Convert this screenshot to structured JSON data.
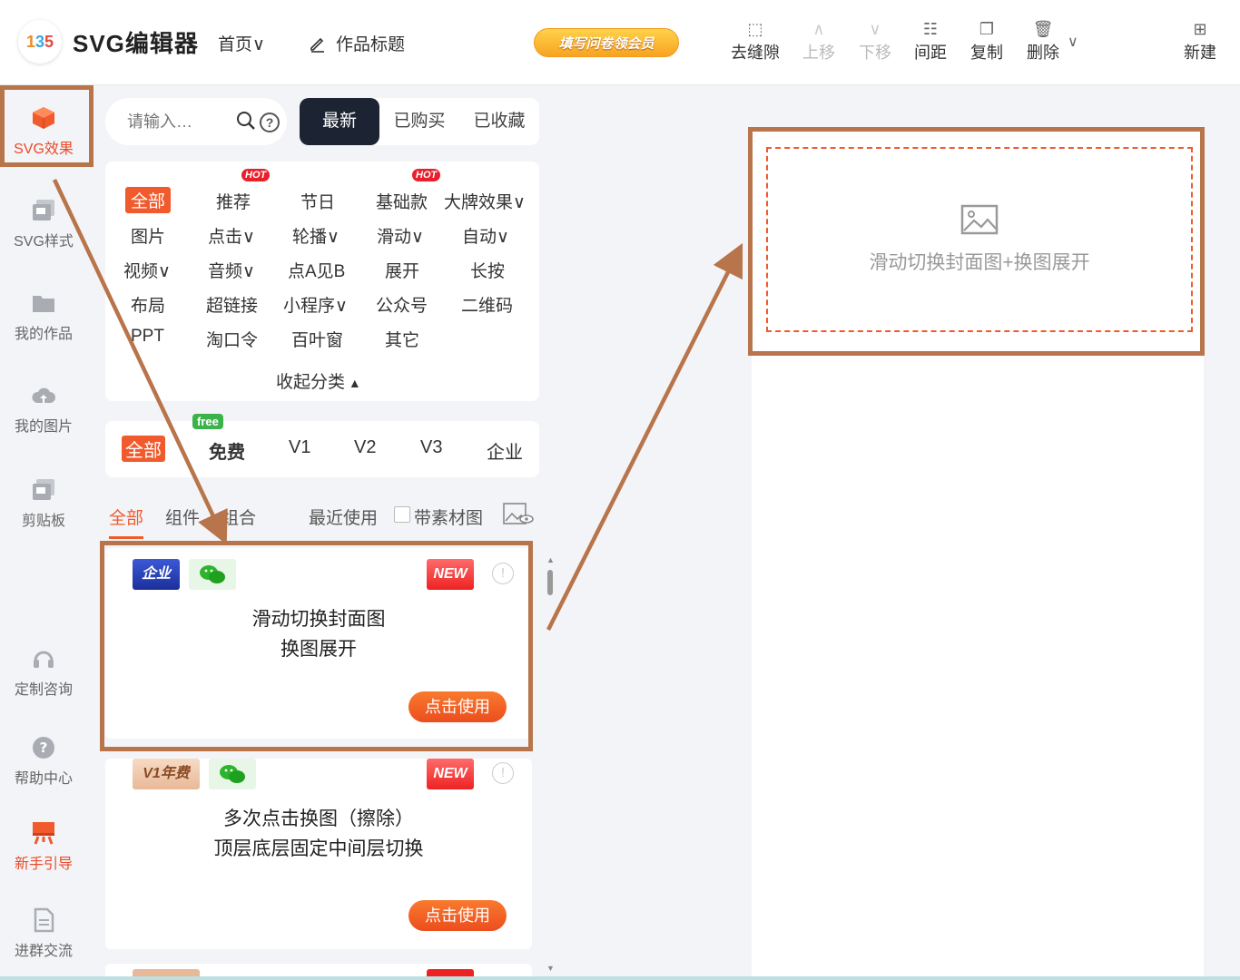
{
  "header": {
    "app_title": "SVG编辑器",
    "logo_text": [
      "1",
      "3",
      "5"
    ],
    "home_menu": "首页∨",
    "work_title": "作品标题",
    "promo": "填写问卷领会员",
    "toolbar": {
      "remove_gap": "去缝隙",
      "move_up": "上移",
      "move_down": "下移",
      "spacing": "间距",
      "copy": "复制",
      "delete": "删除",
      "new": "新建"
    }
  },
  "leftnav": {
    "items": [
      {
        "label": "SVG效果",
        "icon": "cube-icon"
      },
      {
        "label": "SVG样式",
        "icon": "style-icon"
      },
      {
        "label": "我的作品",
        "icon": "folder-icon"
      },
      {
        "label": "我的图片",
        "icon": "cloud-upload-icon"
      },
      {
        "label": "剪贴板",
        "icon": "clipboard-icon"
      },
      {
        "label": "定制咨询",
        "icon": "headset-icon"
      },
      {
        "label": "帮助中心",
        "icon": "help-icon"
      },
      {
        "label": "新手引导",
        "icon": "guide-icon"
      },
      {
        "label": "进群交流",
        "icon": "doc-icon"
      }
    ]
  },
  "search": {
    "placeholder": "请输入…"
  },
  "top_tabs": [
    "最新",
    "已购买",
    "已收藏"
  ],
  "categories": {
    "items": [
      "全部",
      "推荐",
      "节日",
      "基础款",
      "大牌效果∨",
      "图片",
      "点击∨",
      "轮播∨",
      "滑动∨",
      "自动∨",
      "视频∨",
      "音频∨",
      "点A见B",
      "展开",
      "长按",
      "布局",
      "超链接",
      "小程序∨",
      "公众号",
      "二维码",
      "PPT",
      "淘口令",
      "百叶窗",
      "其它"
    ],
    "hot_label": "HOT",
    "collapse": "收起分类"
  },
  "versions": {
    "items": [
      "全部",
      "免费",
      "V1",
      "V2",
      "V3",
      "企业"
    ],
    "free_tag": "free"
  },
  "sub_tabs": [
    "全部",
    "组件",
    "组合"
  ],
  "filters": {
    "recent": "最近使用",
    "with_material": "带素材图"
  },
  "cards": [
    {
      "badge": "企业",
      "new": "NEW",
      "title_line1": "滑动切换封面图",
      "title_line2": "换图展开",
      "button": "点击使用"
    },
    {
      "badge": "V1年费",
      "new": "NEW",
      "title_line1": "多次点击换图（擦除）",
      "title_line2": "顶层底层固定中间层切换",
      "button": "点击使用"
    }
  ],
  "canvas": {
    "placeholder_text": "滑动切换封面图+换图展开"
  },
  "colors": {
    "accent": "#f05a2c",
    "annotation": "#b8744a",
    "dark_tab": "#1c2433"
  }
}
